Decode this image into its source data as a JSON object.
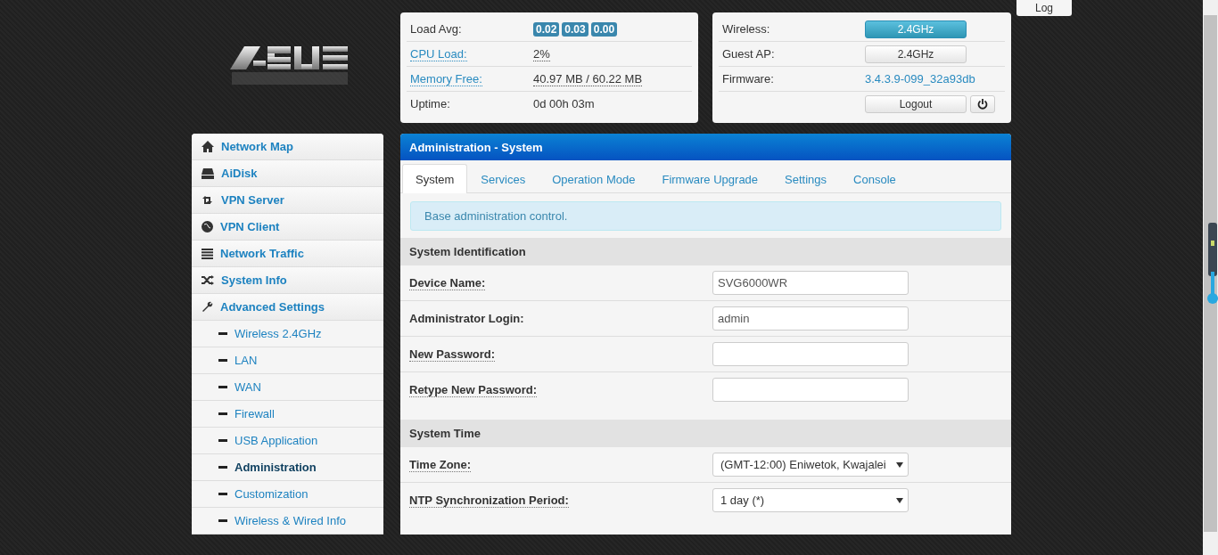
{
  "log_button": "Log",
  "stats": [
    {
      "label": "Load Avg:",
      "kind": "badges",
      "badges": [
        "0.02",
        "0.03",
        "0.00"
      ]
    },
    {
      "label": "CPU Load:",
      "kind": "link",
      "value": "2%"
    },
    {
      "label": "Memory Free:",
      "kind": "link",
      "value": "40.97 MB / 60.22 MB"
    },
    {
      "label": "Uptime:",
      "kind": "plain",
      "value": "0d 00h 03m"
    }
  ],
  "status": [
    {
      "label": "Wireless:",
      "kind": "button",
      "value": "2.4GHz",
      "active": true
    },
    {
      "label": "Guest AP:",
      "kind": "button",
      "value": "2.4GHz",
      "active": false
    },
    {
      "label": "Firmware:",
      "kind": "link",
      "value": "3.4.3.9-099_32a93db"
    }
  ],
  "logout_button": "Logout",
  "sidebar": [
    {
      "label": "Network Map",
      "kind": "main",
      "selected": false
    },
    {
      "label": "AiDisk",
      "kind": "main",
      "selected": false
    },
    {
      "label": "VPN Server",
      "kind": "main",
      "selected": false
    },
    {
      "label": "VPN Client",
      "kind": "main",
      "selected": false
    },
    {
      "label": "Network Traffic",
      "kind": "main",
      "selected": false
    },
    {
      "label": "System Info",
      "kind": "main",
      "selected": false
    },
    {
      "label": "Advanced Settings",
      "kind": "main",
      "selected": false
    },
    {
      "label": "Wireless 2.4GHz",
      "kind": "sub",
      "selected": false
    },
    {
      "label": "LAN",
      "kind": "sub",
      "selected": false
    },
    {
      "label": "WAN",
      "kind": "sub",
      "selected": false
    },
    {
      "label": "Firewall",
      "kind": "sub",
      "selected": false
    },
    {
      "label": "USB Application",
      "kind": "sub",
      "selected": false
    },
    {
      "label": "Administration",
      "kind": "sub",
      "selected": true
    },
    {
      "label": "Customization",
      "kind": "sub",
      "selected": false
    },
    {
      "label": "Wireless & Wired Info",
      "kind": "sub",
      "selected": false
    }
  ],
  "panel": {
    "title": "Administration - System",
    "tabs": [
      {
        "label": "System",
        "selected": true
      },
      {
        "label": "Services",
        "selected": false
      },
      {
        "label": "Operation Mode",
        "selected": false
      },
      {
        "label": "Firmware Upgrade",
        "selected": false
      },
      {
        "label": "Settings",
        "selected": false
      },
      {
        "label": "Console",
        "selected": false
      }
    ],
    "alert": "Base administration control.",
    "sections": [
      {
        "title": "System Identification",
        "fields": [
          {
            "label": "Device Name:",
            "kind": "input",
            "value": "SVG6000WR",
            "tooltip": true
          },
          {
            "label": "Administrator Login:",
            "kind": "input",
            "value": "admin",
            "tooltip": false
          },
          {
            "label": "New Password:",
            "kind": "input",
            "tooltip": true
          },
          {
            "label": "Retype New Password:",
            "kind": "input",
            "tooltip": true
          }
        ]
      },
      {
        "title": "System Time",
        "fields": [
          {
            "label": "Time Zone:",
            "kind": "select",
            "value": "(GMT-12:00) Eniwetok, Kwajalei",
            "tooltip": true
          },
          {
            "label": "NTP Synchronization Period:",
            "kind": "select",
            "value": "1 day (*)",
            "tooltip": true
          }
        ]
      }
    ]
  }
}
